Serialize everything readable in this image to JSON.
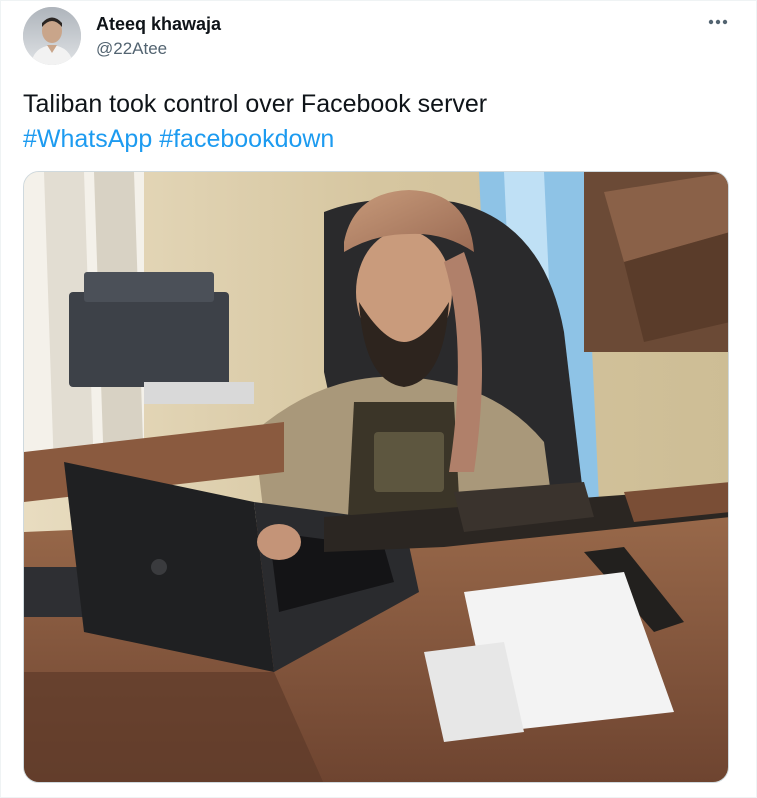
{
  "author": {
    "display_name": "Ateeq khawaja",
    "handle": "@22Atee",
    "avatar_icon": "user-avatar-photo"
  },
  "more_icon": "more-horizontal-icon",
  "tweet": {
    "text_line1": "Taliban took control over Facebook server",
    "hashtags": [
      "#WhatsApp",
      "#facebookdown"
    ]
  },
  "media": {
    "description_icon": "photo-media"
  },
  "colors": {
    "text": "#0f1419",
    "secondary": "#536471",
    "link": "#1d9bf0",
    "border": "#cfd9de"
  }
}
